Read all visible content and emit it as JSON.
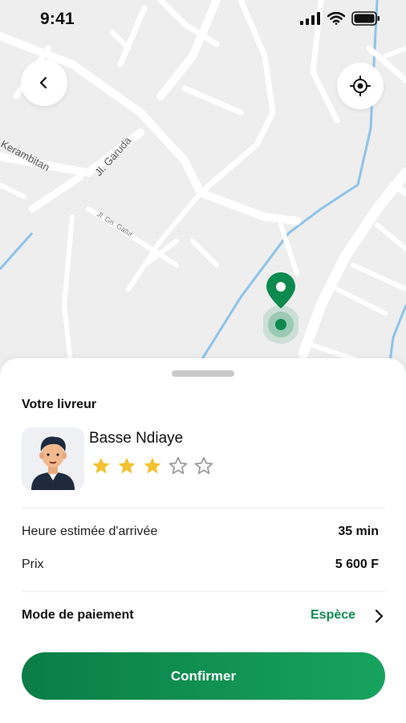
{
  "status_bar": {
    "time": "9:41"
  },
  "map": {
    "street_labels": [
      "Kerambitan",
      "Jl. Garuda",
      "Jl. Gn. Gatur"
    ],
    "colors": {
      "background": "#eeeeee",
      "road": "#ffffff",
      "water": "#8ec3ea",
      "pin": "#0d8a4f"
    }
  },
  "controls": {
    "back_icon": "chevron-left-icon",
    "locate_icon": "crosshair-icon"
  },
  "sheet": {
    "section_title": "Votre livreur",
    "courier": {
      "name": "Basse Ndiaye",
      "rating": 3,
      "max_rating": 5
    },
    "details": [
      {
        "label": "Heure estimée d'arrivée",
        "value": "35 min"
      },
      {
        "label": "Prix",
        "value": "5 600 F"
      }
    ],
    "payment": {
      "label": "Mode de paiement",
      "value": "Espèce"
    },
    "confirm_label": "Confirmer"
  },
  "colors": {
    "accent": "#0d8a4f",
    "star_filled": "#f2c230",
    "star_empty": "#9a9a9a"
  }
}
